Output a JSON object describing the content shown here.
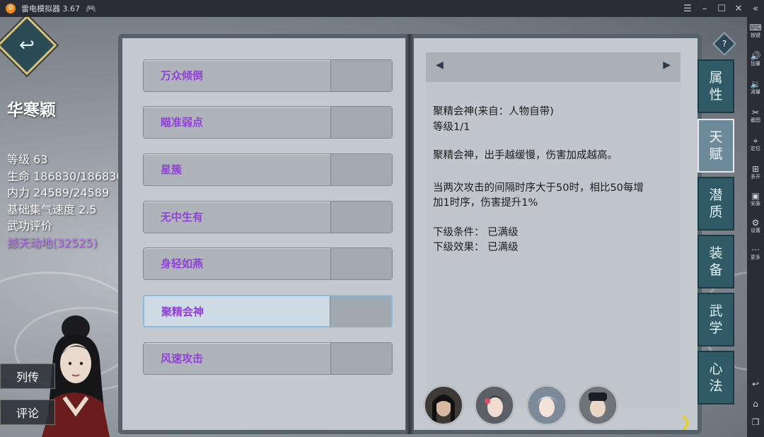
{
  "window": {
    "title": "雷电模拟器 3.67"
  },
  "toolbar": {
    "items": [
      {
        "label": "按键",
        "icon": "keyboard-icon"
      },
      {
        "label": "加量",
        "icon": "volume-up-icon"
      },
      {
        "label": "减量",
        "icon": "volume-down-icon"
      },
      {
        "label": "截图",
        "icon": "scissors-icon"
      },
      {
        "label": "定位",
        "icon": "location-icon"
      },
      {
        "label": "多开",
        "icon": "multi-instance-icon"
      },
      {
        "label": "安装",
        "icon": "apk-install-icon"
      },
      {
        "label": "设置",
        "icon": "gear-icon"
      },
      {
        "label": "更多",
        "icon": "more-icon"
      }
    ]
  },
  "character": {
    "name": "华寒颖",
    "level": "等级 63",
    "hp": "生命 186830/186830",
    "mp": "内力 24589/24589",
    "qi_speed": "基础集气速度 2.5",
    "rating_label": "武功评价",
    "rating_value": "撼天动地(32525)"
  },
  "side_buttons": {
    "biography": "列传",
    "comment": "评论"
  },
  "skills": [
    {
      "name": "万众倾倒"
    },
    {
      "name": "瞄准弱点"
    },
    {
      "name": "星簇"
    },
    {
      "name": "无中生有"
    },
    {
      "name": "身轻如燕"
    },
    {
      "name": "聚精会神"
    },
    {
      "name": "风速攻击"
    }
  ],
  "detail": {
    "title_line": "聚精会神(来自：人物自带)",
    "level_line": "等级1/1",
    "summary": "聚精会神，出手越缓慢，伤害加成越高。",
    "effect_line1": "当两次攻击的间隔时序大于50时，相比50每增",
    "effect_line2": "加1时序，伤害提升1%",
    "next_condition": "下级条件：  已满级",
    "next_effect": "下级效果：  已满级"
  },
  "help_label": "?",
  "tabs": [
    {
      "label": "属\n性"
    },
    {
      "label": "天\n赋"
    },
    {
      "label": "潜\n质"
    },
    {
      "label": "装\n备"
    },
    {
      "label": "武\n学"
    },
    {
      "label": "心\n法"
    }
  ],
  "colors": {
    "accent_purple": "#9340d8",
    "tab_teal": "#2f5a66",
    "arrow_gold": "#e6cf35"
  }
}
